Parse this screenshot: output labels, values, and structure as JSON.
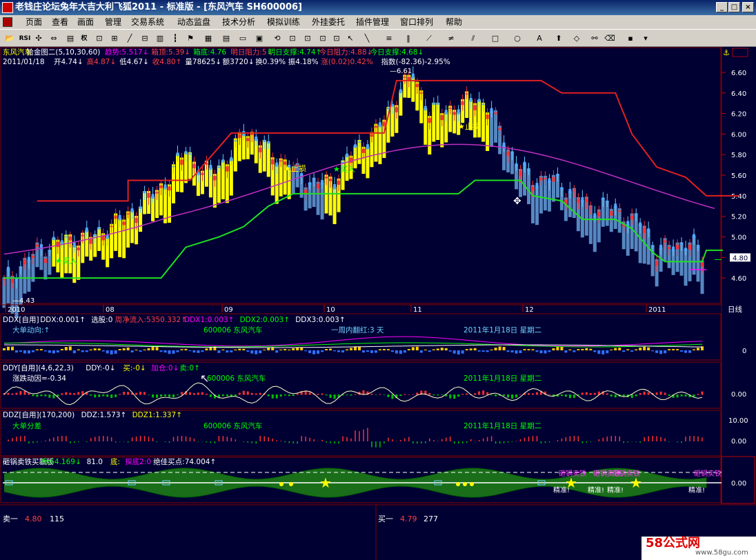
{
  "window": {
    "title": "老钱庄论坛兔年大吉大利飞狐2011 - 标准版 - [东风汽车 SH600006]"
  },
  "menu": [
    "页面",
    "查看",
    "画面",
    "管理",
    "交易系统",
    "动态监盘",
    "技术分析",
    "模拟训练",
    "外挂委托",
    "插件管理",
    "窗口排列",
    "帮助"
  ],
  "toolbar": {
    "rsi_label": "RSI",
    "quan_label": "权"
  },
  "main_chart": {
    "header1": [
      {
        "text": "东风汽车",
        "color": "#ffff00"
      },
      {
        "text": "拾金图二(5,10,30,60)",
        "color": "#ffffff"
      },
      {
        "text": "趋势:5.517↓",
        "color": "#ff00ff"
      },
      {
        "text": "箱顶:5.39↓",
        "color": "#ff4040"
      },
      {
        "text": "箱底:4.76",
        "color": "#00ff00"
      },
      {
        "text": "明日阻力:5↓",
        "color": "#ff4040"
      },
      {
        "text": "明日支撑:4.74↑",
        "color": "#00ff00"
      },
      {
        "text": "今日阻力:4.88↓",
        "color": "#ff4040"
      },
      {
        "text": "今日支撑:4.68↓",
        "color": "#00ff00"
      }
    ],
    "header2": [
      {
        "text": "2011/01/18",
        "color": "#ffffff"
      },
      {
        "text": "开4.74↓",
        "color": "#ffffff"
      },
      {
        "text": "高4.87↓",
        "color": "#ff4040"
      },
      {
        "text": "低4.67↓",
        "color": "#ffffff"
      },
      {
        "text": "收4.80↑",
        "color": "#ff4040"
      },
      {
        "text": "量78625↓",
        "color": "#ffffff"
      },
      {
        "text": "额3720↓",
        "color": "#ffffff"
      },
      {
        "text": "换0.39%",
        "color": "#ffffff"
      },
      {
        "text": "振4.18%",
        "color": "#ffffff"
      },
      {
        "text": "涨(0.02)0.42%",
        "color": "#ff4040"
      },
      {
        "text": "指数(-82.36)-2.95%",
        "color": "#ffffff"
      }
    ],
    "y_ticks": [
      "6.60",
      "6.40",
      "6.20",
      "6.00",
      "5.80",
      "5.60",
      "5.40",
      "5.20",
      "5.00",
      "4.80",
      "4.60"
    ],
    "current_price": "4.80",
    "high_label": "6.61",
    "low_label": "4.43",
    "annotations": {
      "buy1": "★买入",
      "buy2": "★买入",
      "stop1": "★止损",
      "stop2": "★止损"
    },
    "x_axis": [
      "2010",
      "08",
      "09",
      "10",
      "11",
      "12",
      "2011"
    ],
    "x_axis_corner": "日线"
  },
  "ddx_panel": {
    "header": [
      {
        "text": "DDX[自用]",
        "color": "#ffffff"
      },
      {
        "text": "DDX:0.001↑",
        "color": "#ffffff"
      },
      {
        "text": "选股:0",
        "color": "#ffffff"
      },
      {
        "text": "周净流入:5350.332↑",
        "color": "#ff4040"
      },
      {
        "text": "DDX1:0.003↑",
        "color": "#ff00ff"
      },
      {
        "text": "DDX2:0.003↑",
        "color": "#00ff00"
      },
      {
        "text": "DDX3:0.003↑",
        "color": "#ffffff"
      }
    ],
    "label": "大单动向:↑",
    "stock": "600006 东风汽车",
    "week_red": "一周内翻红:3 天",
    "date": "2011年1月18日 星期二",
    "y_tick": "0"
  },
  "ddy_panel": {
    "header": [
      {
        "text": "DDY[自用](4,6,22,3)",
        "color": "#ffffff"
      },
      {
        "text": "DDY:-0↓",
        "color": "#ffffff"
      },
      {
        "text": "买:-0↓",
        "color": "#ffff00"
      },
      {
        "text": "加仓:0↓",
        "color": "#ff00ff"
      },
      {
        "text": "卖:0↑",
        "color": "#00ff00"
      }
    ],
    "label": "涨跌动因=-0.34",
    "stock": "600006 东风汽车",
    "date": "2011年1月18日 星期二",
    "y_tick": "0.00"
  },
  "ddz_panel": {
    "header": [
      {
        "text": "DDZ[自用](170,200)",
        "color": "#ffffff"
      },
      {
        "text": "DDZ:1.573↑",
        "color": "#ffffff"
      },
      {
        "text": "DDZ1:1.337↑",
        "color": "#ffff00"
      }
    ],
    "label": "大单分差",
    "stock": "600006 东风汽车",
    "date": "2011年1月18日 星期二",
    "y_ticks": [
      "10.00",
      "0.00"
    ]
  },
  "pot_panel": {
    "header": [
      {
        "text": "砸锅卖铁买新版",
        "color": "#ffffff"
      },
      {
        "text": "桥:64.169↓",
        "color": "#00ff00"
      },
      {
        "text": "81.0",
        "color": "#ffffff"
      },
      {
        "text": "底:",
        "color": "#ffff00"
      },
      {
        "text": "探底2:0",
        "color": "#ff00ff"
      },
      {
        "text": "绝佳买点:74.004↑",
        "color": "#ffffff"
      }
    ],
    "y_tick": "0.00",
    "signal_top": "砸锅卖铁",
    "signal_bottom": "精准!"
  },
  "quote_bar": {
    "sell1_label": "卖一",
    "sell1_price": "4.80",
    "sell1_vol": "115",
    "buy1_label": "买一",
    "buy1_price": "4.79",
    "buy1_vol": "277"
  },
  "watermark": {
    "brand": "58公式网",
    "url": "www.58gu.com"
  },
  "colors": {
    "bg": "#000033",
    "grid": "#800000",
    "up": "#ff3030",
    "down": "#4f8fd8",
    "yellow_bar": "#ffff00",
    "steel_bar": "#5b8fc8",
    "resistance": "#e02020",
    "support": "#20e020",
    "trend": "#c030c0"
  }
}
